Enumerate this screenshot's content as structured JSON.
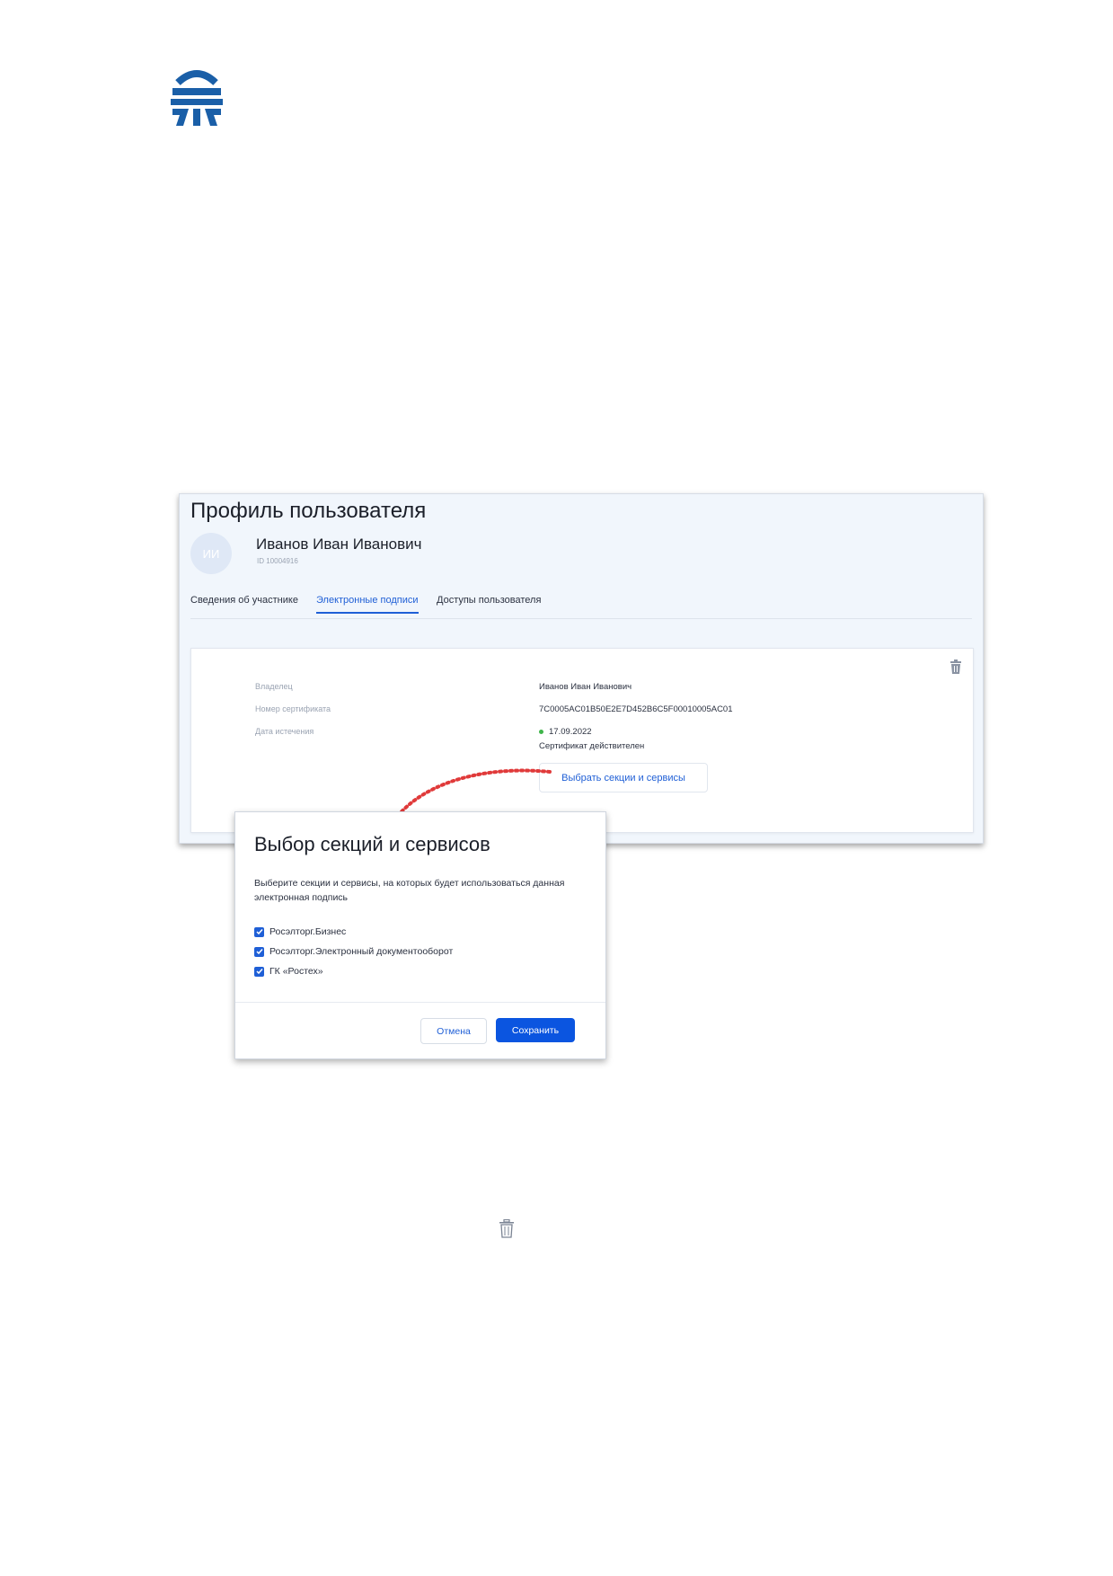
{
  "profile": {
    "title": "Профиль пользователя",
    "avatar_initials": "ИИ",
    "user_name": "Иванов Иван Иванович",
    "user_id": "ID 10004916",
    "tabs": [
      {
        "label": "Сведения об участнике",
        "active": false
      },
      {
        "label": "Электронные подписи",
        "active": true
      },
      {
        "label": "Доступы пользователя",
        "active": false
      }
    ]
  },
  "signature_card": {
    "rows": [
      {
        "label": "Владелец",
        "value": "Иванов Иван Иванович"
      },
      {
        "label": "Номер сертификата",
        "value": "7C0005AC01B50E2E7D452B6C5F00010005AC01"
      },
      {
        "label": "Дата истечения",
        "value": "17.09.2022"
      }
    ],
    "status_text": "Сертификат действителен",
    "status_color": "#3fb54a",
    "select_button_label": "Выбрать секции и сервисы",
    "delete_icon": "trash-icon"
  },
  "modal": {
    "title": "Выбор секций и сервисов",
    "description": "Выберите секции и сервисы, на которых будет использоваться данная электронная подпись",
    "options": [
      {
        "label": "Росэлторг.Бизнес",
        "checked": true
      },
      {
        "label": "Росэлторг.Электронный документооборот",
        "checked": true
      },
      {
        "label": "ГК «Ростех»",
        "checked": true
      }
    ],
    "cancel_label": "Отмена",
    "save_label": "Сохранить"
  },
  "colors": {
    "accent": "#1f5fd6",
    "primary_button": "#0b55e0",
    "arrow": "#e03a3a",
    "logo": "#1a5fa8"
  },
  "standalone_icon": "trash-icon"
}
